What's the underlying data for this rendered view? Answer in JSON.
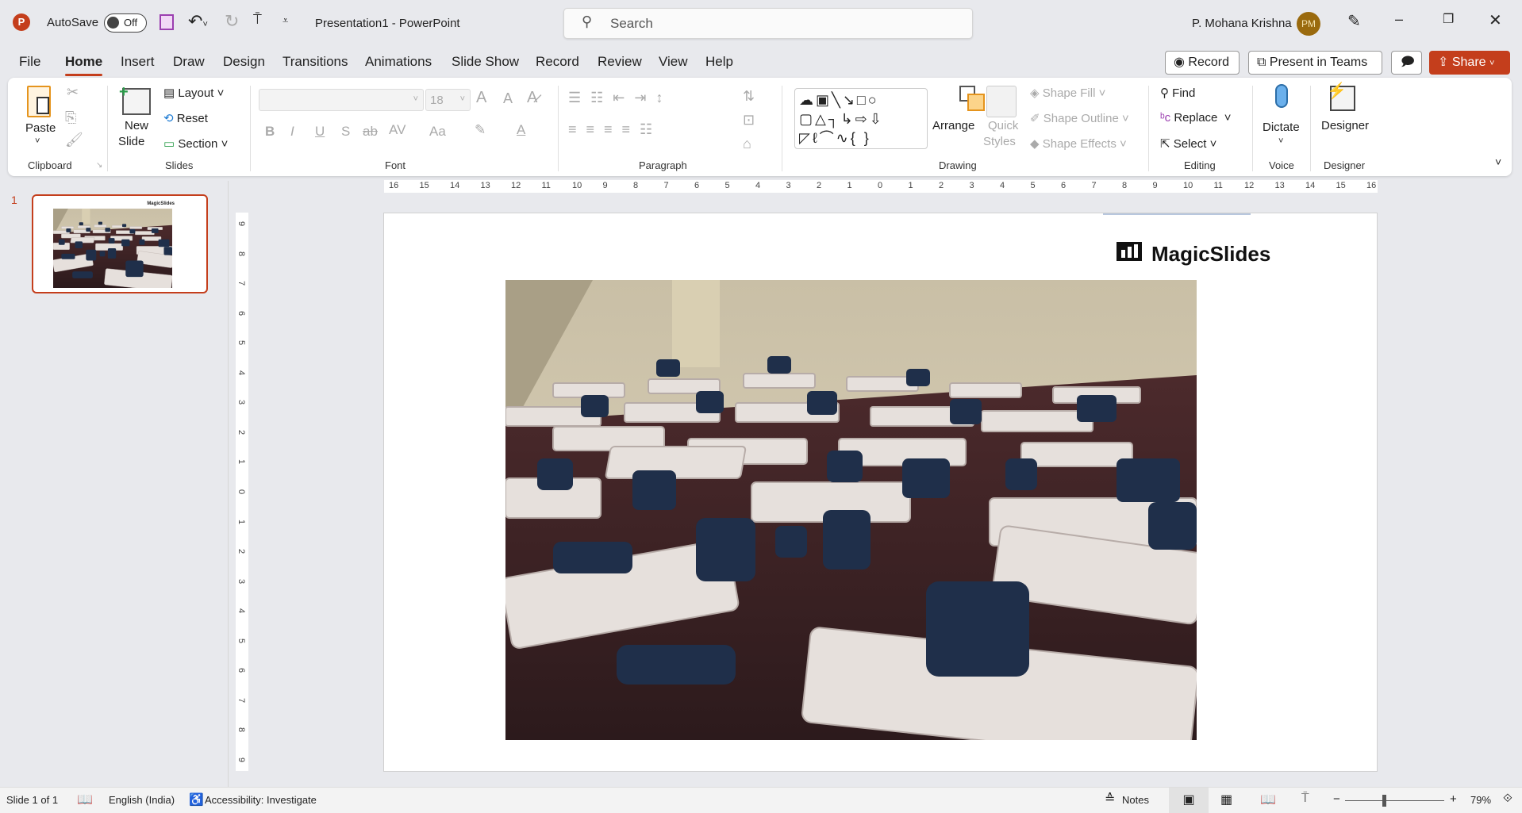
{
  "titlebar": {
    "app_icon": "P",
    "autosave_label": "AutoSave",
    "autosave_state": "Off",
    "title": "Presentation1  -  PowerPoint",
    "search_placeholder": "Search",
    "user_name": "P. Mohana Krishna",
    "avatar_initials": "PM"
  },
  "tabs": [
    "File",
    "Home",
    "Insert",
    "Draw",
    "Design",
    "Transitions",
    "Animations",
    "Slide Show",
    "Record",
    "Review",
    "View",
    "Help"
  ],
  "active_tab": "Home",
  "actions": {
    "record": "Record",
    "present_teams": "Present in Teams",
    "share": "Share"
  },
  "ribbon": {
    "clipboard": {
      "paste": "Paste",
      "label": "Clipboard"
    },
    "slides": {
      "new_slide_1": "New",
      "new_slide_2": "Slide",
      "layout": "Layout",
      "reset": "Reset",
      "section": "Section",
      "label": "Slides"
    },
    "font": {
      "font_name": "",
      "font_size": "18",
      "bold": "B",
      "italic": "I",
      "underline": "U",
      "shadow": "S",
      "strike": "ab",
      "spacing": "AV",
      "case": "Aa",
      "color": "A",
      "grow": "A",
      "shrink": "A",
      "label": "Font"
    },
    "paragraph": {
      "label": "Paragraph"
    },
    "drawing": {
      "arrange": "Arrange",
      "quick_styles_1": "Quick",
      "quick_styles_2": "Styles",
      "shape_fill": "Shape Fill",
      "shape_outline": "Shape Outline",
      "shape_effects": "Shape Effects",
      "label": "Drawing"
    },
    "editing": {
      "find": "Find",
      "replace": "Replace",
      "select": "Select",
      "label": "Editing"
    },
    "voice": {
      "dictate": "Dictate",
      "label": "Voice"
    },
    "designer": {
      "designer": "Designer",
      "label": "Designer"
    }
  },
  "slides_panel": {
    "slide_number": "1"
  },
  "ruler_h": [
    "16",
    "15",
    "14",
    "13",
    "12",
    "11",
    "10",
    "9",
    "8",
    "7",
    "6",
    "5",
    "4",
    "3",
    "2",
    "1",
    "0",
    "1",
    "2",
    "3",
    "4",
    "5",
    "6",
    "7",
    "8",
    "9",
    "10",
    "11",
    "12",
    "13",
    "14",
    "15",
    "16"
  ],
  "ruler_v": [
    "9",
    "8",
    "7",
    "6",
    "5",
    "4",
    "3",
    "2",
    "1",
    "0",
    "1",
    "2",
    "3",
    "4",
    "5",
    "6",
    "7",
    "8",
    "9"
  ],
  "slide": {
    "logo_text": "MagicSlides"
  },
  "status": {
    "slide_info": "Slide 1 of 1",
    "language": "English (India)",
    "accessibility": "Accessibility: Investigate",
    "notes": "Notes",
    "zoom": "79%"
  },
  "colors": {
    "accent": "#c43e1c",
    "avatar": "#9a6a0e"
  }
}
